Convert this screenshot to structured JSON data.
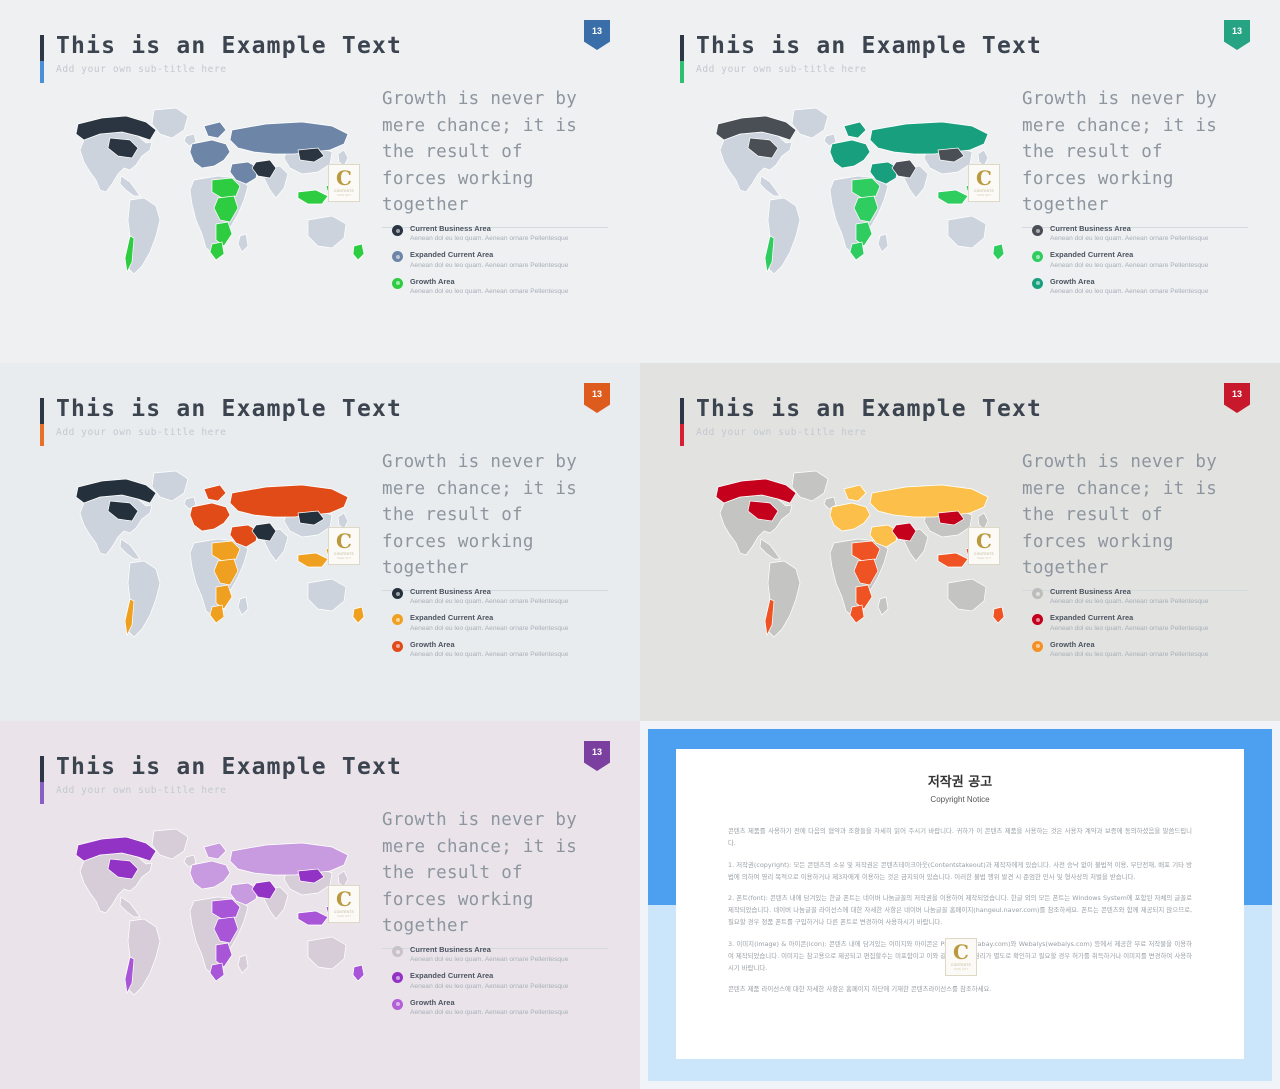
{
  "slides": [
    {
      "id": "slide-blue",
      "badge": "13",
      "badge_color": "#3a6ea8",
      "bg": "#eef0f2",
      "title": "This is an Example Text",
      "subtitle": "Add your own sub-title here",
      "accent_top": "#2d3748",
      "accent_bottom": "#4a90d9",
      "quote_lines": [
        "Growth is never by",
        "mere chance; it is",
        "the result of",
        "forces working",
        "together"
      ],
      "map_base": "#ccd3dc",
      "legend": [
        {
          "label": "Current Business Area",
          "desc": "Aenean dol eu leo quam. Aenean ornare Pellentesque",
          "color": "#2b3542"
        },
        {
          "label": "Expanded Current Area",
          "desc": "Aenean dol eu leo quam. Aenean ornare Pellentesque",
          "color": "#6d86a8"
        },
        {
          "label": "Growth Area",
          "desc": "Aenean dol eu leo quam. Aenean ornare Pellentesque",
          "color": "#2ecc40"
        }
      ]
    },
    {
      "id": "slide-green",
      "badge": "13",
      "badge_color": "#26a383",
      "bg": "#eef0f2",
      "title": "This is an Example Text",
      "subtitle": "Add your own sub-title here",
      "accent_top": "#2d3748",
      "accent_bottom": "#2fbf71",
      "quote_lines": [
        "Growth is never by",
        "mere chance; it is",
        "the result of",
        "forces working",
        "together"
      ],
      "map_base": "#ccd3dc",
      "legend": [
        {
          "label": "Current Business Area",
          "desc": "Aenean dol eu leo quam. Aenean ornare Pellentesque",
          "color": "#4a4f55"
        },
        {
          "label": "Expanded Current Area",
          "desc": "Aenean dol eu leo quam. Aenean ornare Pellentesque",
          "color": "#2fcc5f"
        },
        {
          "label": "Growth Area",
          "desc": "Aenean dol eu leo quam. Aenean ornare Pellentesque",
          "color": "#18a07e"
        }
      ]
    },
    {
      "id": "slide-orange",
      "badge": "13",
      "badge_color": "#dd5b1d",
      "bg": "#e9ecee",
      "title": "This is an Example Text",
      "subtitle": "Add your own sub-title here",
      "accent_top": "#2d3748",
      "accent_bottom": "#e8712a",
      "quote_lines": [
        "Growth is never by",
        "mere chance; it is",
        "the result of",
        "forces working",
        "together"
      ],
      "map_base": "#ccd3dc",
      "legend": [
        {
          "label": "Current Business Area",
          "desc": "Aenean dol eu leo quam. Aenean ornare Pellentesque",
          "color": "#25303d"
        },
        {
          "label": "Expanded Current Area",
          "desc": "Aenean dol eu leo quam. Aenean ornare Pellentesque",
          "color": "#f0a020"
        },
        {
          "label": "Growth Area",
          "desc": "Aenean dol eu leo quam. Aenean ornare Pellentesque",
          "color": "#e04b18"
        }
      ]
    },
    {
      "id": "slide-red",
      "badge": "13",
      "badge_color": "#c7182c",
      "bg": "#e2e2e0",
      "title": "This is an Example Text",
      "subtitle": "Add your own sub-title here",
      "accent_top": "#2d3748",
      "accent_bottom": "#d61f33",
      "quote_lines": [
        "Growth is never by",
        "mere chance; it is",
        "the result of",
        "forces working",
        "together"
      ],
      "map_base": "#c4c4c2",
      "legend": [
        {
          "label": "Current Business Area",
          "desc": "Aenean dol eu leo quam. Aenean ornare Pellentesque",
          "color": "#bdbdbb"
        },
        {
          "label": "Expanded Current Area",
          "desc": "Aenean dol eu leo quam. Aenean ornare Pellentesque",
          "color": "#c4001c"
        },
        {
          "label": "Growth Area",
          "desc": "Aenean dol eu leo quam. Aenean ornare Pellentesque",
          "color": "#f59025"
        }
      ]
    },
    {
      "id": "slide-purple",
      "badge": "13",
      "badge_color": "#7b3fa0",
      "bg": "#eae4ea",
      "title": "This is an Example Text",
      "subtitle": "Add your own sub-title here",
      "accent_top": "#2d3748",
      "accent_bottom": "#8a5fc4",
      "quote_lines": [
        "Growth is never by",
        "mere chance; it is",
        "the result of",
        "forces working",
        "together"
      ],
      "map_base": "#d7cdd8",
      "legend": [
        {
          "label": "Current Business Area",
          "desc": "Aenean dol eu leo quam. Aenean ornare Pellentesque",
          "color": "#c9c2ca"
        },
        {
          "label": "Expanded Current Area",
          "desc": "Aenean dol eu leo quam. Aenean ornare Pellentesque",
          "color": "#9333c6"
        },
        {
          "label": "Growth Area",
          "desc": "Aenean dol eu leo quam. Aenean ornare Pellentesque",
          "color": "#b45fd8"
        }
      ]
    }
  ],
  "map_themes": {
    "slide-blue": {
      "dark": "#2b3542",
      "mid": "#6d86a8",
      "bright": "#2ecc40",
      "light": "#dfe3e8"
    },
    "slide-green": {
      "dark": "#4a4f55",
      "mid": "#18a07e",
      "bright": "#2fcc5f",
      "light": "#dfe3e8"
    },
    "slide-orange": {
      "dark": "#25303d",
      "mid": "#e04b18",
      "bright": "#f0a020",
      "light": "#dfe3e8"
    },
    "slide-red": {
      "dark": "#c4001c",
      "mid": "#fcc04a",
      "bright": "#ef5223",
      "light": "#c9c9c7"
    },
    "slide-purple": {
      "dark": "#9333c6",
      "mid": "#c89ae0",
      "bright": "#a855d8",
      "light": "#ded4df"
    }
  },
  "logo": {
    "letter": "C",
    "name": "CONTENTS",
    "tagline": "TAKE OUT"
  },
  "copyright_slide": {
    "id": "slide-copyright",
    "frame_top_color": "#4d9ff0",
    "frame_bottom_color": "#cbe5fb",
    "title_ko": "저작권 공고",
    "title_en": "Copyright Notice",
    "paragraphs": [
      "콘텐츠 제품를 사용하기 전에 다음의 협약과 조항들을 자세히 읽어 주시기 바랍니다. 귀하가 이 콘텐츠 제품을 사용하는 것은 사용자 계약과 보증에 동의하셨음을 말씀드립니다.",
      "1. 저작권(copyright): 모든 콘텐츠의 소유 및 저작권은 콘텐츠테이크아웃(Contentstakeout)과 제작자에게 있습니다. 사전 승낙 없이 불법적 이용, 무단전재, 배포 기타 방법에 의하여 영리 목적으로 이용하거나 제3자에게 이용하는 것은 금지되어 있습니다. 이러한 불법 행위 발견 시 준엄한 민사 및 형사상의 처벌을 받습니다.",
      "2. 폰트(font): 콘텐츠 내에 담겨있는 한글 폰트는 네이버 나눔글꼴의 저작권을 이용하여 제작되었습니다. 한글 외의 모든 폰트는 Windows System에 포함된 자체의 글꼴로 제작되었습니다. 네이버 나눔글꼴 라이선스에 대한 자세한 사항은 네이버 나눔글꼴 홈페이지(hangeul.naver.com)를 참조하세요. 폰트는 콘텐츠와 함께 제공되지 않으므로, 필요할 경우 정품 폰트를 구입하거나 다른 폰트로 변경하여 사용하시기 바랍니다.",
      "3. 이미지(image) & 아이콘(icon): 콘텐츠 내에 담겨있는 이미지와 아이콘은 Pixabay(pixabay.com)와 Webalys(webalys.com) 등에서 제공한 무료 저작물을 이용하여 제작되었습니다. 이미지는 참고용으로 제공되고 편집할수는 미포함이고 이와 같은 것에는 권리가 별도로 확인하고 필요할 경우 허가를 취득하거나 이미지를 변경하여 사용하시기 바랍니다.",
      "콘텐츠 제품 라이선스에 대한 자세한 사항은 홈페이지 하단에 기재한 콘텐츠라이선스를 참조하세요."
    ]
  }
}
